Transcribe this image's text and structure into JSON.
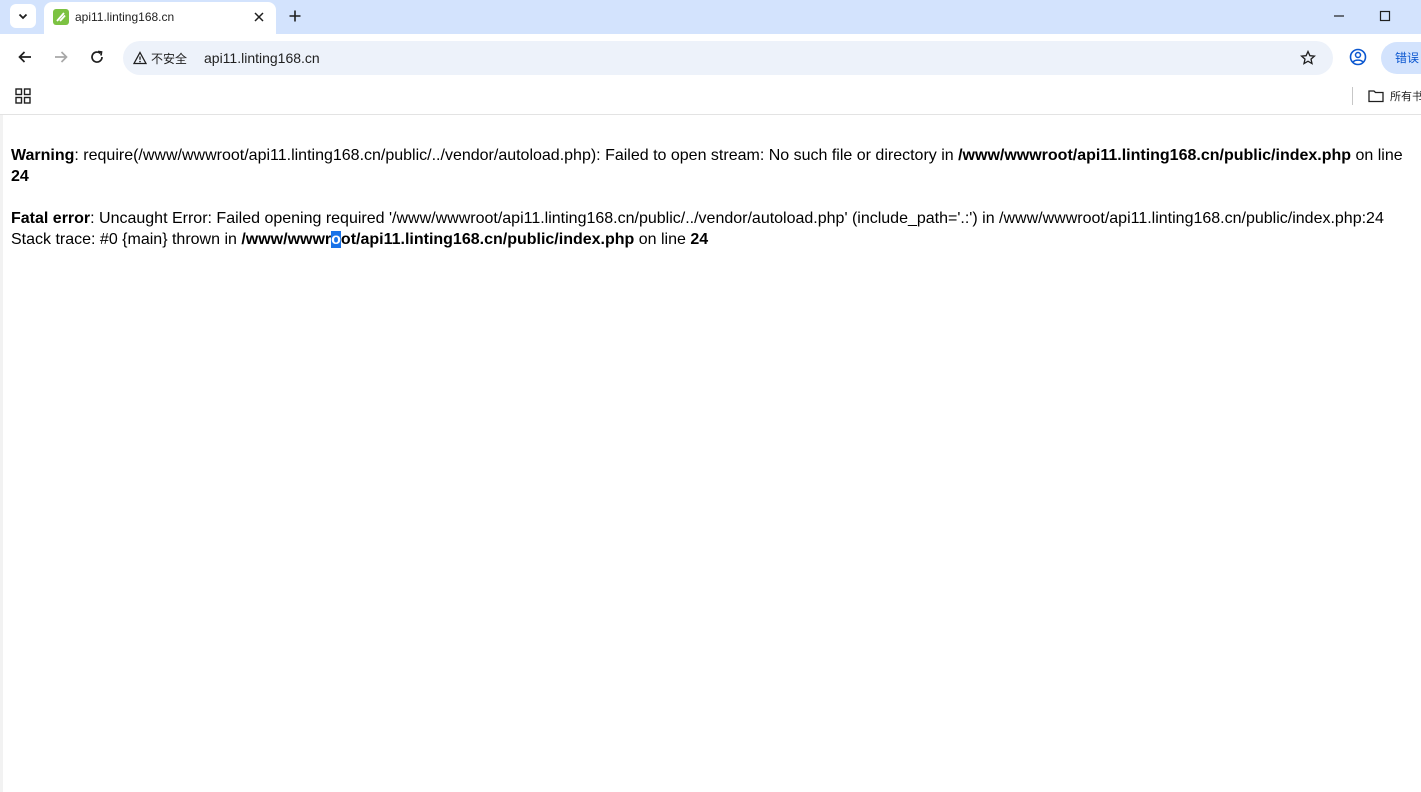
{
  "browser": {
    "tab": {
      "title": "api11.linting168.cn"
    },
    "address_bar": {
      "security_label": "不安全",
      "url": "api11.linting168.cn"
    },
    "error_chip_label": "错误",
    "bookmarks": {
      "folder_label": "所有书签"
    }
  },
  "page": {
    "warning": {
      "label": "Warning",
      "message": ": require(/www/wwwroot/api11.linting168.cn/public/../vendor/autoload.php): Failed to open stream: No such file or directory in ",
      "file": "/www/wwwroot/api11.linting168.cn/public/index.php",
      "on_line": " on line ",
      "line": "24"
    },
    "fatal": {
      "label": "Fatal error",
      "message": ": Uncaught Error: Failed opening required '/www/wwwroot/api11.linting168.cn/public/../vendor/autoload.php' (include_path='.:') in /www/wwwroot/api11.linting168.cn/public/index.php:24 Stack trace: #0 {main} thrown in ",
      "file_before_selection": "/www/wwwr",
      "file_selected": "o",
      "file_after_selection": "ot/api11.linting168.cn/public/index.php",
      "on_line": " on line ",
      "line": "24"
    }
  }
}
